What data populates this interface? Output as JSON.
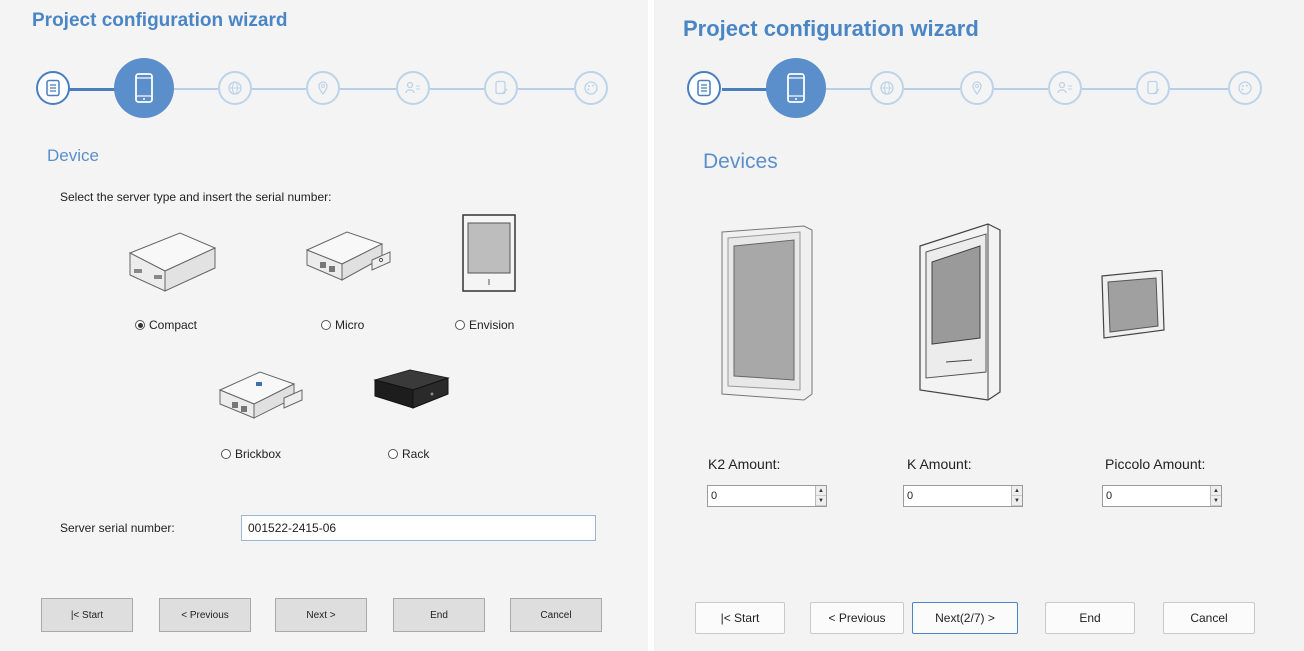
{
  "left": {
    "title": "Project configuration wizard",
    "section": "Device",
    "instruction": "Select the server type and insert the serial number:",
    "server_types": [
      {
        "label": "Compact",
        "selected": true
      },
      {
        "label": "Micro",
        "selected": false
      },
      {
        "label": "Envision",
        "selected": false
      },
      {
        "label": "Brickbox",
        "selected": false
      },
      {
        "label": "Rack",
        "selected": false
      }
    ],
    "serial_label": "Server serial number:",
    "serial_value": "001522-2415-06",
    "buttons": {
      "start": "|< Start",
      "previous": "< Previous",
      "next": "Next >",
      "end": "End",
      "cancel": "Cancel"
    }
  },
  "right": {
    "title": "Project configuration wizard",
    "section": "Devices",
    "amounts": [
      {
        "label": "K2 Amount:",
        "value": "0"
      },
      {
        "label": "K Amount:",
        "value": "0"
      },
      {
        "label": "Piccolo Amount:",
        "value": "0"
      }
    ],
    "buttons": {
      "start": "|< Start",
      "previous": "< Previous",
      "next": "Next(2/7) >",
      "end": "End",
      "cancel": "Cancel"
    }
  },
  "steps": [
    {
      "icon": "document-list-icon",
      "state": "done"
    },
    {
      "icon": "mobile-device-icon",
      "state": "current"
    },
    {
      "icon": "globe-icon",
      "state": "pending"
    },
    {
      "icon": "location-pin-icon",
      "state": "pending"
    },
    {
      "icon": "user-list-icon",
      "state": "pending"
    },
    {
      "icon": "document-edit-icon",
      "state": "pending"
    },
    {
      "icon": "palette-icon",
      "state": "pending"
    }
  ],
  "colors": {
    "accent": "#4a86c5",
    "step_pending": "#bcd3ea",
    "step_current": "#5b8fcb"
  }
}
